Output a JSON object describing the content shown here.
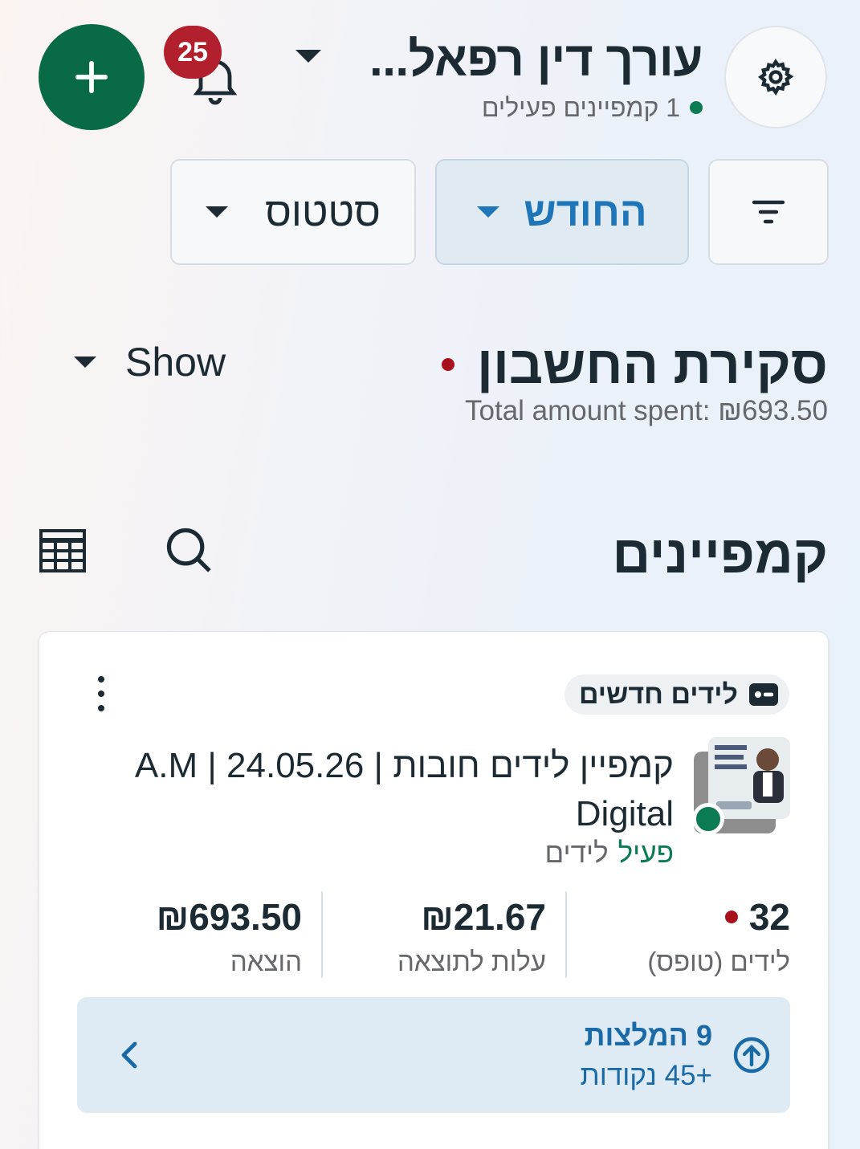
{
  "header": {
    "account_name": "עורך דין רפאל...",
    "active_campaigns": "1 קמפיינים פעילים",
    "notification_count": "25"
  },
  "filters": {
    "month_label": "החודש",
    "status_label": "סטטוס"
  },
  "overview": {
    "title": "סקירת החשבון",
    "total_spent": "Total amount spent: ₪693.50",
    "show_label": "Show"
  },
  "campaigns": {
    "title": "קמפיינים",
    "items": [
      {
        "objective": "לידים חדשים",
        "name": "קמפיין לידים חובות | 24.05.26 | A.M Digital",
        "status": "פעיל",
        "type": "לידים",
        "metrics": [
          {
            "value": "32",
            "label": "לידים (טופס)"
          },
          {
            "value": "₪21.67",
            "label": "עלות לתוצאה"
          },
          {
            "value": "₪693.50",
            "label": "הוצאה"
          }
        ],
        "recommendations": {
          "title": "9 המלצות",
          "points": "+45 נקודות"
        }
      }
    ]
  },
  "colors": {
    "primary_green": "#086b45",
    "badge_red": "#b21f2d",
    "accent_blue": "#1e75b8"
  }
}
